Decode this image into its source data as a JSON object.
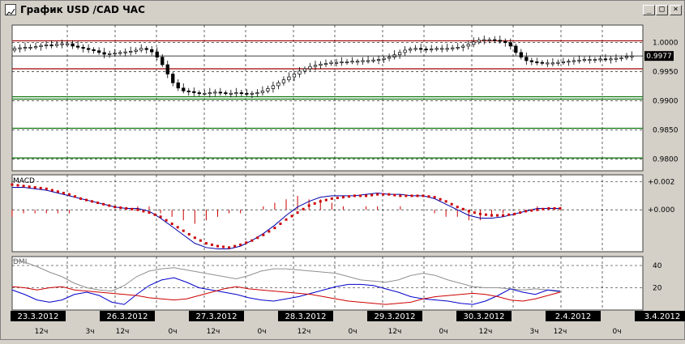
{
  "window": {
    "title": "График USD /CAD  ЧАС",
    "buttons": {
      "minimize": "_",
      "maximize": "□",
      "close": "×"
    }
  },
  "colors": {
    "background": "#ffffff",
    "frame": "#d4d0c8",
    "grid": "#000000",
    "candles": "#000000",
    "resistance": "#a00000",
    "support": "#007000",
    "macd_line": "#0000aa",
    "macd_signal": "#cc0000",
    "macd_hist": "#cc0000",
    "dmi_adx": "#909090",
    "dmi_plus": "#0000cc",
    "dmi_minus": "#cc0000",
    "date_label_bg": "#000000",
    "date_label_fg": "#ffffff"
  },
  "chart_data": [
    {
      "type": "candlestick",
      "ylim": [
        0.978,
        1.003
      ],
      "yticks": [
        "1.0000",
        "0.9950",
        "0.9900",
        "0.9850",
        "0.9800"
      ],
      "current_price": "0.9977",
      "horizontal_levels": [
        {
          "kind": "resistance",
          "value": 1.0003
        },
        {
          "kind": "resistance",
          "value": 0.9955
        },
        {
          "kind": "support",
          "value": 0.9907
        },
        {
          "kind": "support",
          "value": 0.9903
        },
        {
          "kind": "support",
          "value": 0.9853
        },
        {
          "kind": "support",
          "value": 0.9802
        }
      ],
      "bars": 118,
      "close": [
        0.999,
        0.9991,
        0.9992,
        0.9992,
        0.9993,
        0.9995,
        0.9996,
        0.9995,
        0.9997,
        0.9998,
        0.9998,
        0.9994,
        0.9992,
        0.999,
        0.9988,
        0.9986,
        0.9983,
        0.998,
        0.9981,
        0.9982,
        0.9983,
        0.9984,
        0.9985,
        0.9987,
        0.999,
        0.9988,
        0.9984,
        0.9975,
        0.9962,
        0.9946,
        0.9931,
        0.9922,
        0.9917,
        0.9916,
        0.9914,
        0.9913,
        0.9913,
        0.9914,
        0.9915,
        0.9914,
        0.9913,
        0.9913,
        0.9914,
        0.9913,
        0.9912,
        0.9913,
        0.9914,
        0.9917,
        0.9921,
        0.9926,
        0.9931,
        0.9936,
        0.9941,
        0.9946,
        0.9951,
        0.9955,
        0.9959,
        0.9961,
        0.9963,
        0.9964,
        0.9966,
        0.9966,
        0.9967,
        0.9967,
        0.9968,
        0.9968,
        0.9969,
        0.9969,
        0.997,
        0.9971,
        0.9973,
        0.9975,
        0.9979,
        0.9983,
        0.9987,
        0.9989,
        0.999,
        0.9989,
        0.9988,
        0.9989,
        0.999,
        0.999,
        0.999,
        0.9991,
        0.9992,
        0.9994,
        0.9997,
        1.0001,
        1.0004,
        1.0005,
        1.0005,
        1.0004,
        1.0002,
        1.0,
        0.9994,
        0.9983,
        0.9975,
        0.9969,
        0.9967,
        0.9966,
        0.9965,
        0.9965,
        0.9965,
        0.9966,
        0.9967,
        0.9968,
        0.9969,
        0.997,
        0.9971,
        0.9971,
        0.9971,
        0.9972,
        0.9971,
        0.9972,
        0.9973,
        0.9974,
        0.9976,
        0.9977
      ]
    },
    {
      "type": "macd",
      "label": "MACD",
      "ylim": [
        -0.003,
        0.0025
      ],
      "yticks": [
        {
          "label": "+0.002",
          "value": 0.002
        },
        {
          "label": "+0.000",
          "value": 0.0
        }
      ],
      "macd": [
        0.0016,
        0.0016,
        0.0015,
        0.0014,
        0.0012,
        0.001,
        0.0008,
        0.0006,
        0.0004,
        0.0002,
        0.0001,
        0.0001,
        -0.0001,
        -0.0006,
        -0.0012,
        -0.0018,
        -0.0024,
        -0.0027,
        -0.0028,
        -0.0028,
        -0.0026,
        -0.0022,
        -0.0017,
        -0.0011,
        -0.0004,
        0.0002,
        0.0006,
        0.0009,
        0.001,
        0.001,
        0.001,
        0.0011,
        0.0012,
        0.0011,
        0.0011,
        0.001,
        0.001,
        0.0008,
        0.0004,
        0.0,
        -0.0004,
        -0.0006,
        -0.0006,
        -0.0005,
        -0.0003,
        -0.0001,
        0.0001,
        0.0001,
        0.0001
      ],
      "signal": [
        0.0018,
        0.0017,
        0.0016,
        0.0015,
        0.0013,
        0.0011,
        0.0008,
        0.0006,
        0.0004,
        0.0002,
        0.0001,
        0.0,
        -0.0002,
        -0.0005,
        -0.001,
        -0.0015,
        -0.002,
        -0.0024,
        -0.0026,
        -0.0027,
        -0.0025,
        -0.0022,
        -0.0018,
        -0.0013,
        -0.0007,
        -0.0002,
        0.0003,
        0.0006,
        0.0008,
        0.0009,
        0.001,
        0.001,
        0.0011,
        0.0011,
        0.001,
        0.001,
        0.001,
        0.0009,
        0.0006,
        0.0002,
        -0.0001,
        -0.0003,
        -0.0004,
        -0.0004,
        -0.0003,
        -0.0001,
        0.0,
        0.0001,
        0.0001
      ]
    },
    {
      "type": "dmi",
      "label": "DMI",
      "ylim": [
        0,
        48
      ],
      "yticks": [
        {
          "label": "40",
          "value": 40
        },
        {
          "label": "20",
          "value": 20
        }
      ],
      "adx": [
        45,
        43,
        39,
        34,
        30,
        24,
        20,
        18,
        17,
        22,
        30,
        35,
        37,
        38,
        36,
        34,
        32,
        30,
        28,
        31,
        35,
        37,
        37,
        36,
        35,
        34,
        33,
        30,
        27,
        26,
        25,
        27,
        31,
        33,
        31,
        27,
        24,
        21,
        20,
        20,
        19,
        18,
        19,
        18,
        16
      ],
      "plus_di": [
        18,
        14,
        9,
        7,
        9,
        14,
        16,
        13,
        7,
        5,
        14,
        22,
        27,
        29,
        25,
        20,
        18,
        16,
        14,
        11,
        9,
        8,
        10,
        12,
        15,
        18,
        21,
        23,
        23,
        22,
        19,
        16,
        12,
        10,
        9,
        8,
        6,
        5,
        8,
        13,
        19,
        16,
        14,
        18,
        17
      ],
      "minus_di": [
        21,
        20,
        18,
        20,
        21,
        18,
        17,
        16,
        15,
        14,
        13,
        11,
        10,
        9,
        10,
        13,
        16,
        19,
        21,
        19,
        18,
        17,
        16,
        15,
        14,
        12,
        10,
        8,
        7,
        6,
        5,
        6,
        7,
        10,
        12,
        13,
        14,
        15,
        14,
        12,
        9,
        8,
        10,
        13,
        16
      ]
    }
  ],
  "date_labels": [
    {
      "date": "23.3.2012",
      "x": 0.0
    },
    {
      "date": "26.3.2012",
      "x": 1.0
    },
    {
      "date": "27.3.2012",
      "x": 2.0
    },
    {
      "date": "28.3.2012",
      "x": 3.0
    },
    {
      "date": "29.3.2012",
      "x": 4.0
    },
    {
      "date": "30.3.2012",
      "x": 5.0
    },
    {
      "date": "2.4.2012",
      "x": 6.0
    },
    {
      "date": "3.4.2012",
      "x": 7.0
    }
  ],
  "hour_labels": [
    "12ч",
    "3ч",
    "12ч",
    "0ч",
    "12ч",
    "0ч",
    "12ч",
    "0ч",
    "12ч",
    "0ч",
    "12ч",
    "3ч",
    "12ч",
    "0ч"
  ]
}
